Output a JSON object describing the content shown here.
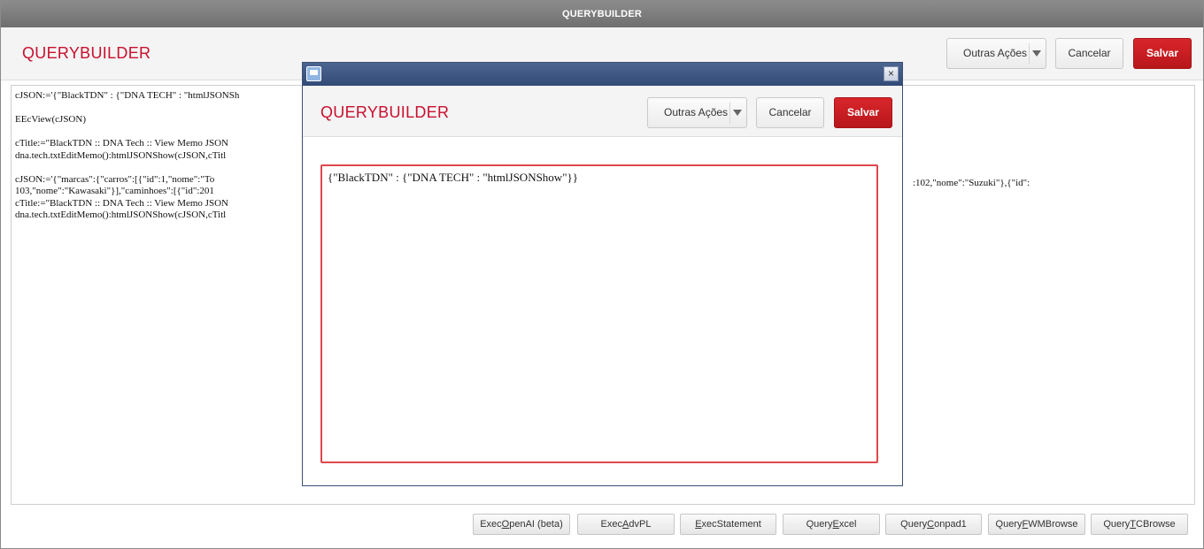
{
  "window": {
    "title": "QUERYBUILDER"
  },
  "header": {
    "app_title": "QUERYBUILDER",
    "actions_label": "Outras Ações",
    "cancel_label": "Cancelar",
    "save_label": "Salvar"
  },
  "editor": {
    "lines": [
      "cJSON:='{\"BlackTDN\" : {\"DNA TECH\" : \"htmlJSONSh",
      "",
      "EEcView(cJSON)",
      "",
      "cTitle:=\"BlackTDN :: DNA Tech :: View Memo JSON",
      "dna.tech.txtEditMemo():htmlJSONShow(cJSON,cTitl",
      "",
      "cJSON:='{\"marcas\":{\"carros\":[{\"id\":1,\"nome\":\"To",
      "103,\"nome\":\"Kawasaki\"}],\"caminhoes\":[{\"id\":201",
      "cTitle:=\"BlackTDN :: DNA Tech :: View Memo JSON",
      "dna.tech.txtEditMemo():htmlJSONShow(cJSON,cTitl"
    ],
    "line8_tail": ":102,\"nome\":\"Suzuki\"},{\"id\":"
  },
  "dialog": {
    "title": "QUERYBUILDER",
    "actions_label": "Outras Ações",
    "cancel_label": "Cancelar",
    "save_label": "Salvar",
    "close_glyph": "×",
    "memo_value": "{\"BlackTDN\" : {\"DNA TECH\" : \"htmlJSONShow\"}}"
  },
  "toolbar": {
    "buttons": [
      {
        "pre": "Exec",
        "key": "O",
        "post": "penAI (beta)"
      },
      {
        "pre": "Exec",
        "key": "A",
        "post": "dvPL"
      },
      {
        "pre": "",
        "key": "E",
        "post": "xecStatement"
      },
      {
        "pre": "Query",
        "key": "E",
        "post": "xcel"
      },
      {
        "pre": "Query",
        "key": "C",
        "post": "onpad1"
      },
      {
        "pre": "Query",
        "key": "F",
        "post": "WMBrowse"
      },
      {
        "pre": "Query",
        "key": "T",
        "post": "CBrowse"
      }
    ]
  },
  "colors": {
    "brand_red": "#c8102e",
    "primary_button": "#c8181d",
    "dialog_titlebar": "#3d5683",
    "invalid_border": "#e0474c"
  }
}
